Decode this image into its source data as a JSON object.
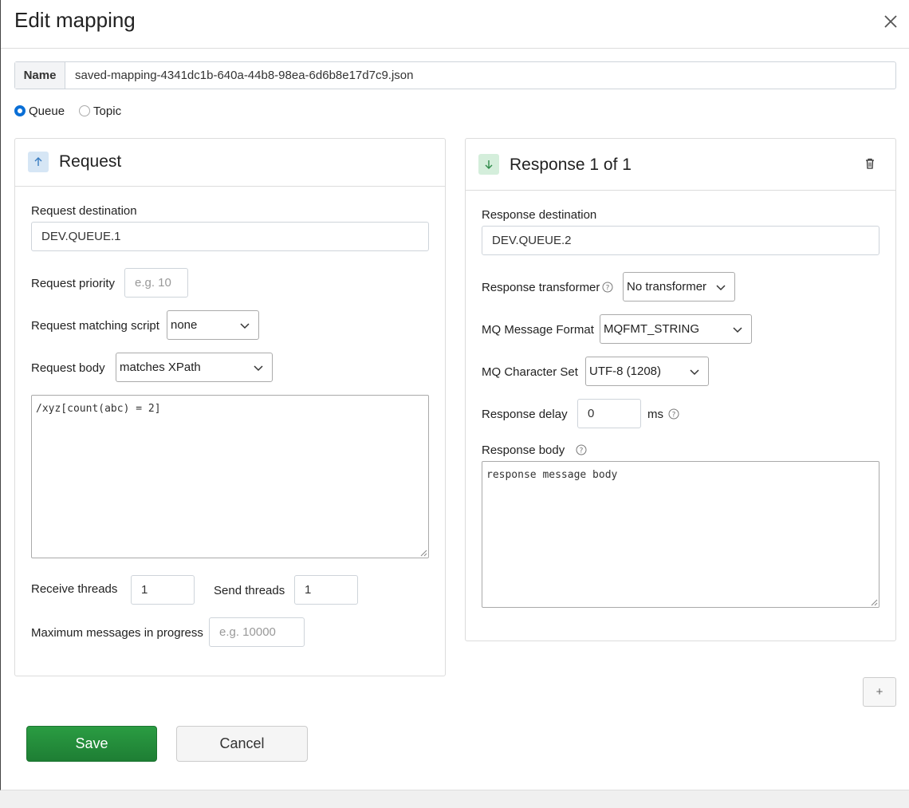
{
  "header": {
    "title": "Edit mapping"
  },
  "name": {
    "label": "Name",
    "value": "saved-mapping-4341dc1b-640a-44b8-98ea-6d6b8e17d7c9.json"
  },
  "mode": {
    "queue_label": "Queue",
    "topic_label": "Topic",
    "selected": "Queue"
  },
  "request": {
    "title": "Request",
    "destination_label": "Request destination",
    "destination_value": "DEV.QUEUE.1",
    "priority_label": "Request priority",
    "priority_placeholder": "e.g. 10",
    "matching_script_label": "Request matching script",
    "matching_script_value": "none",
    "body_label": "Request body",
    "body_match_value": "matches XPath",
    "body_text": "/xyz[count(abc) = 2]",
    "receive_threads_label": "Receive threads",
    "receive_threads_value": "1",
    "send_threads_label": "Send threads",
    "send_threads_value": "1",
    "max_messages_label": "Maximum messages in progress",
    "max_messages_placeholder": "e.g. 10000"
  },
  "response": {
    "title": "Response 1 of 1",
    "destination_label": "Response destination",
    "destination_value": "DEV.QUEUE.2",
    "transformer_label": "Response transformer",
    "transformer_value": "No transformer",
    "format_label": "MQ Message Format",
    "format_value": "MQFMT_STRING",
    "charset_label": "MQ Character Set",
    "charset_value": "UTF-8 (1208)",
    "delay_label": "Response delay",
    "delay_value": "0",
    "delay_unit": "ms",
    "body_label": "Response body",
    "body_text": "response message body"
  },
  "actions": {
    "add_label": "+",
    "save_label": "Save",
    "cancel_label": "Cancel"
  },
  "colors": {
    "save_bg": "#218838",
    "radio_accent": "#0a6fd6",
    "request_icon_bg": "#d6e6f5",
    "response_icon_bg": "#d4eedb"
  }
}
